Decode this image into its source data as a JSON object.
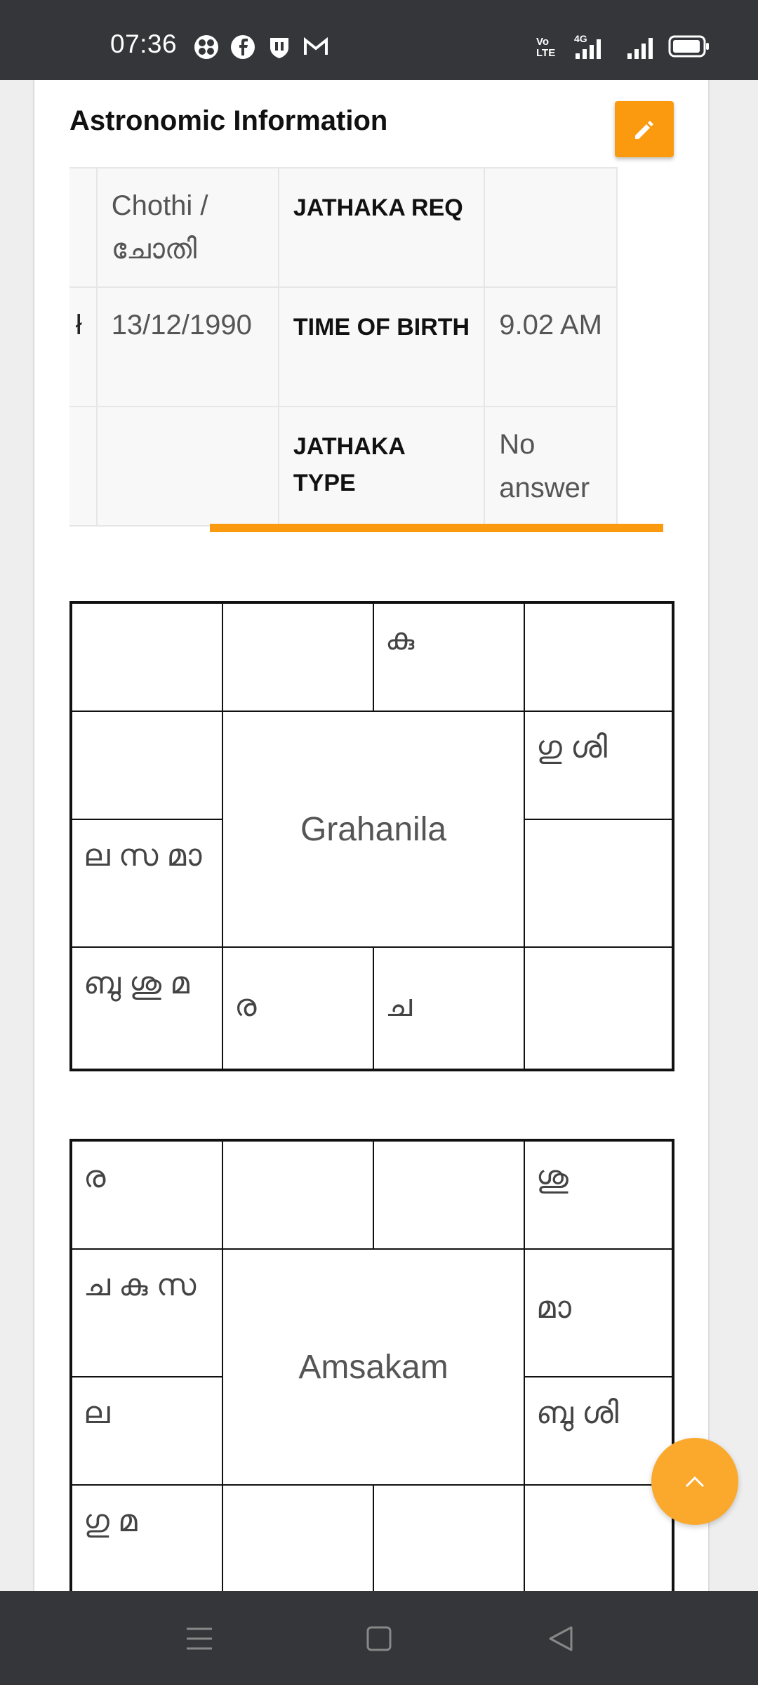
{
  "status_bar": {
    "time": "07:36",
    "app_icons": [
      "pinwheel-icon",
      "facebook-icon",
      "shield-icon",
      "gmail-icon"
    ],
    "right_icons": [
      "volte-icon",
      "4g-signal-icon",
      "signal-icon",
      "battery-icon"
    ],
    "volte_text": "Vo LTE",
    "network_text": "4G"
  },
  "section": {
    "title": "Astronomic Information",
    "edit_icon": "pencil-icon"
  },
  "info_table": {
    "rows": [
      {
        "c1": "",
        "c2": "Chothi / ചോതി",
        "c3": "JATHAKA REQ",
        "c4": ""
      },
      {
        "c1": "ł",
        "c2": "13/12/1990",
        "c3": "TIME OF BIRTH",
        "c4": "9.02 AM"
      },
      {
        "c1": "",
        "c2": "",
        "c3": "JATHAKA TYPE",
        "c4": "No answer"
      }
    ]
  },
  "grahanila": {
    "title": "Grahanila",
    "r1": [
      "",
      "",
      "കു",
      ""
    ],
    "left": [
      "",
      "ല സ മാ"
    ],
    "right": [
      "ഗു ശി",
      ""
    ],
    "r4": [
      "ബു ശു മ",
      "ര",
      "ച",
      ""
    ]
  },
  "amsakam": {
    "title": "Amsakam",
    "r1": [
      "ര",
      "",
      "",
      "ശു"
    ],
    "left": [
      "ച കു സ",
      "ല"
    ],
    "right": [
      "മാ",
      "ബു ശി"
    ],
    "r4": [
      "ഗു മ",
      "",
      "",
      ""
    ]
  },
  "colors": {
    "accent": "#fb9a0e",
    "fab": "#fba92c",
    "system_bar": "#35363a"
  }
}
